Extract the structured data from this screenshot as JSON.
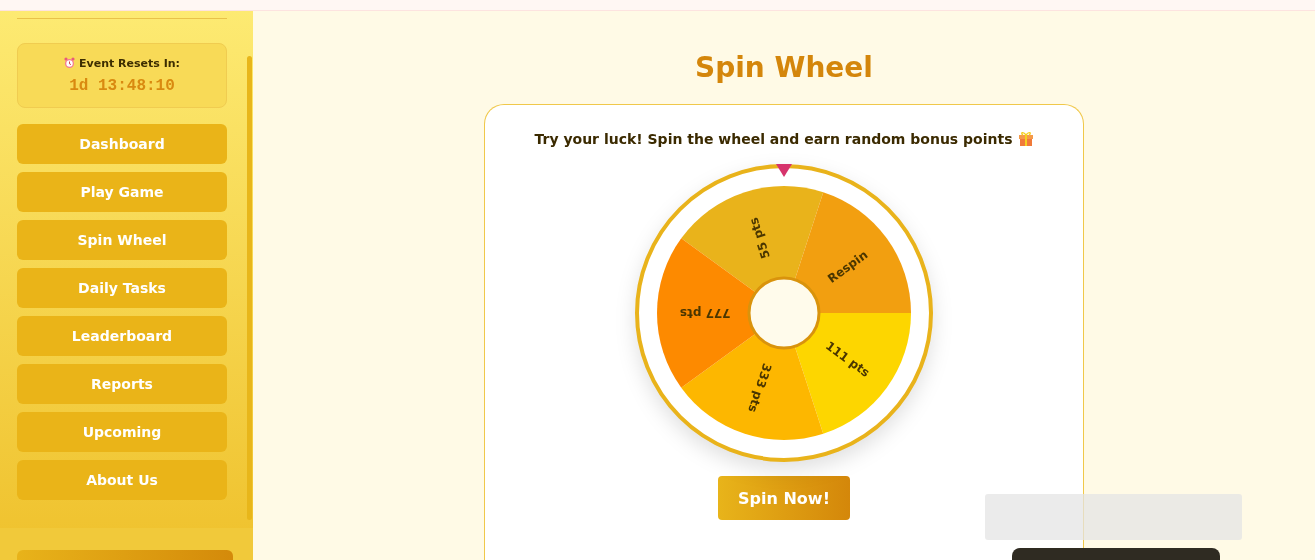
{
  "sidebar": {
    "timer": {
      "label": "Event Resets In:",
      "value": "1d 13:48:10"
    },
    "items": [
      {
        "label": "Dashboard",
        "selected": false
      },
      {
        "label": "Play Game",
        "selected": false
      },
      {
        "label": "Spin Wheel",
        "selected": false
      },
      {
        "label": "Daily Tasks",
        "selected": false
      },
      {
        "label": "Leaderboard",
        "selected": false
      },
      {
        "label": "Reports",
        "selected": false
      },
      {
        "label": "Upcoming",
        "selected": false
      },
      {
        "label": "About Us",
        "selected": false
      }
    ]
  },
  "main": {
    "title": "Spin Wheel",
    "subtitle": "Try your luck! Spin the wheel and earn random bonus points",
    "wheel": {
      "segments": [
        {
          "label": "55 pts",
          "color": "#e9b31b"
        },
        {
          "label": "Respin",
          "color": "#f29f10"
        },
        {
          "label": "111 pts",
          "color": "#fdd600"
        },
        {
          "label": "333 pts",
          "color": "#fdb700"
        },
        {
          "label": "777 pts",
          "color": "#fd8a00"
        }
      ]
    },
    "button": "Spin Now!"
  }
}
